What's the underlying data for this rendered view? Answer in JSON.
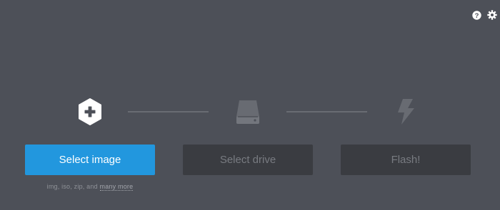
{
  "header": {
    "icons": {
      "help": "question-circle-icon",
      "settings": "gear-icon"
    }
  },
  "steps": {
    "image": {
      "icon": "plus-hexagon-icon",
      "button_label": "Select image",
      "formats_text": "img, iso, zip, and",
      "more_link": "many more"
    },
    "drive": {
      "icon": "hard-drive-icon",
      "button_label": "Select drive"
    },
    "flash": {
      "icon": "lightning-bolt-icon",
      "button_label": "Flash!"
    }
  },
  "colors": {
    "background": "#4d5058",
    "accent": "#2297de",
    "disabled_button": "#3a3c41",
    "disabled_text": "#787b81",
    "connector": "#696c73"
  }
}
